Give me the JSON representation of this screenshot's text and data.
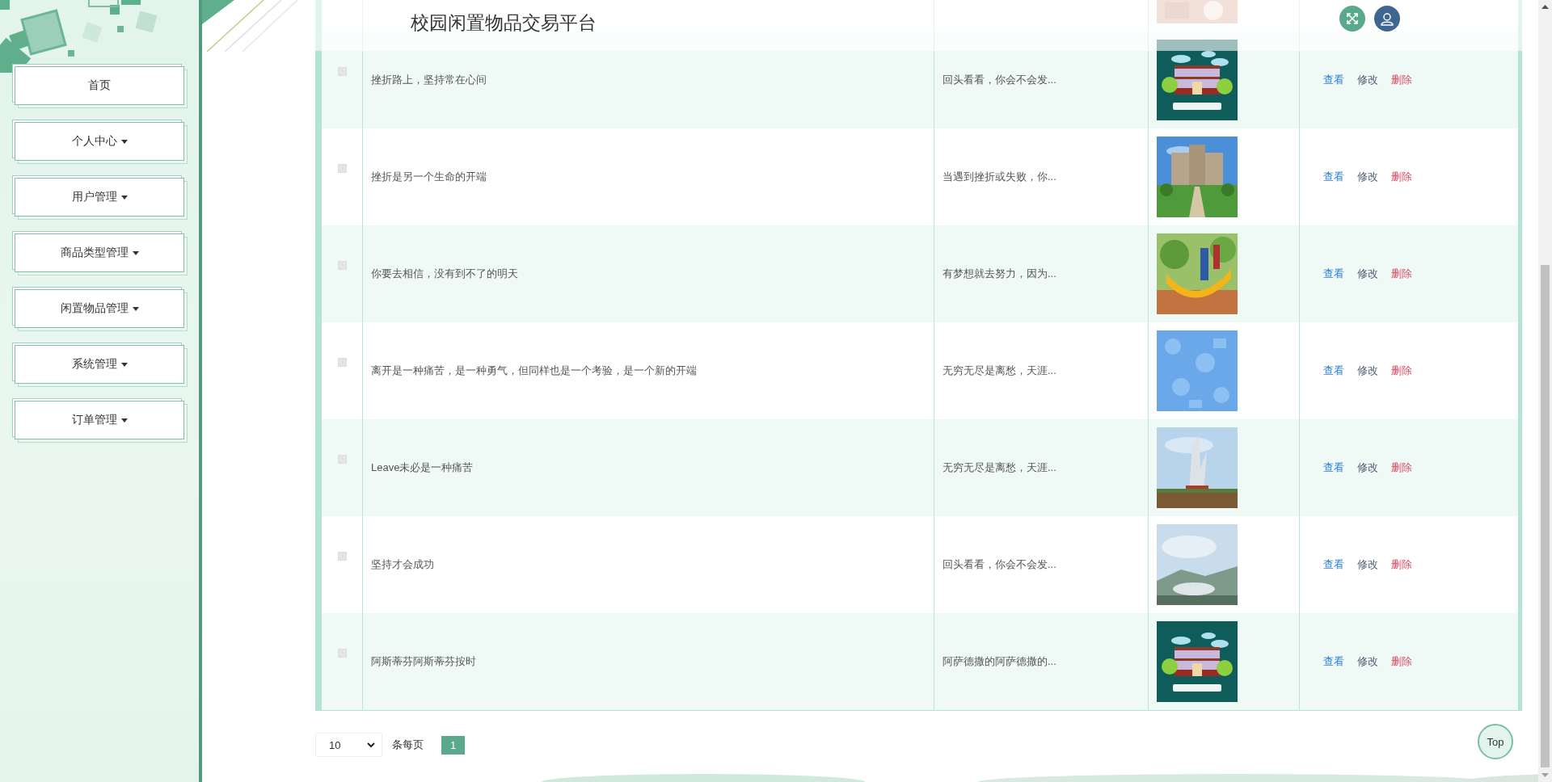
{
  "sidebar": {
    "items": [
      {
        "label": "首页",
        "dropdown": false
      },
      {
        "label": "个人中心",
        "dropdown": true
      },
      {
        "label": "用户管理",
        "dropdown": true
      },
      {
        "label": "商品类型管理",
        "dropdown": true
      },
      {
        "label": "闲置物品管理",
        "dropdown": true
      },
      {
        "label": "系统管理",
        "dropdown": true
      },
      {
        "label": "订单管理",
        "dropdown": true
      }
    ]
  },
  "header": {
    "title": "校园闲置物品交易平台"
  },
  "table": {
    "rows": [
      {
        "kind": "partial"
      },
      {
        "kind": "full",
        "checked": false,
        "title": "挫折路上，坚持常在心间",
        "summary": "回头看看，你会不会发...",
        "actions": [
          {
            "label": "查看",
            "kind": "view"
          },
          {
            "label": "修改",
            "kind": "edit"
          },
          {
            "label": "删除",
            "kind": "delete"
          }
        ]
      },
      {
        "kind": "full",
        "checked": false,
        "title": "挫折是另一个生命的开端",
        "summary": "当遇到挫折或失败，你...",
        "actions": [
          {
            "label": "查看",
            "kind": "view"
          },
          {
            "label": "修改",
            "kind": "edit"
          },
          {
            "label": "删除",
            "kind": "delete"
          }
        ]
      },
      {
        "kind": "full",
        "checked": false,
        "title": "你要去相信，没有到不了的明天",
        "summary": "有梦想就去努力，因为...",
        "actions": [
          {
            "label": "查看",
            "kind": "view"
          },
          {
            "label": "修改",
            "kind": "edit"
          },
          {
            "label": "删除",
            "kind": "delete"
          }
        ]
      },
      {
        "kind": "full",
        "checked": false,
        "title": "离开是一种痛苦，是一种勇气，但同样也是一个考验，是一个新的开端",
        "summary": "无穷无尽是离愁，天涯...",
        "actions": [
          {
            "label": "查看",
            "kind": "view"
          },
          {
            "label": "修改",
            "kind": "edit"
          },
          {
            "label": "删除",
            "kind": "delete"
          }
        ]
      },
      {
        "kind": "full",
        "checked": false,
        "title": "Leave未必是一种痛苦",
        "summary": "无穷无尽是离愁，天涯...",
        "actions": [
          {
            "label": "查看",
            "kind": "view"
          },
          {
            "label": "修改",
            "kind": "edit"
          },
          {
            "label": "删除",
            "kind": "delete"
          }
        ]
      },
      {
        "kind": "full",
        "checked": false,
        "title": "坚持才会成功",
        "summary": "回头看看，你会不会发...",
        "actions": [
          {
            "label": "查看",
            "kind": "view"
          },
          {
            "label": "修改",
            "kind": "edit"
          },
          {
            "label": "删除",
            "kind": "delete"
          }
        ]
      },
      {
        "kind": "full",
        "checked": false,
        "title": "阿斯蒂芬阿斯蒂芬按时",
        "summary": "阿萨德撒的阿萨德撒的...",
        "actions": [
          {
            "label": "查看",
            "kind": "view"
          },
          {
            "label": "修改",
            "kind": "edit"
          },
          {
            "label": "删除",
            "kind": "delete"
          }
        ]
      }
    ]
  },
  "pagination": {
    "page_size": "10",
    "page_size_label": "条每页",
    "pages": [
      {
        "label": "1",
        "selected": true
      }
    ]
  },
  "back_to_top": {
    "label": "Top"
  }
}
